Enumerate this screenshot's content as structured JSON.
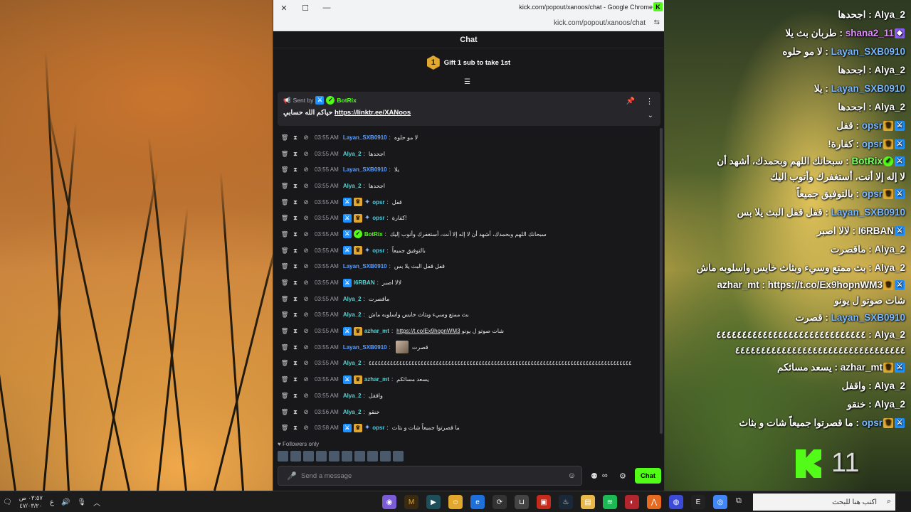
{
  "window": {
    "title": "kick.com/popout/xanoos/chat - Google Chrome",
    "url": "kick.com/popout/xanoos/chat",
    "favicon": "K"
  },
  "chat": {
    "header": "Chat",
    "gift_number": "1",
    "gift_text": "Gift 1 sub to take 1st",
    "pinned": {
      "sent_by": "Sent by",
      "bot": "BotRix",
      "message_prefix": "حياكم الله حسابي",
      "link": "https://linktr.ee/XANoos"
    },
    "messages": [
      {
        "time": "03:55 AM",
        "user": "Layan_SXB0910",
        "text": "لا مو حلوه"
      },
      {
        "time": "03:55 AM",
        "user": "Alya_2",
        "text": "اجحدها"
      },
      {
        "time": "03:55 AM",
        "user": "Layan_SXB0910",
        "text": "يلا"
      },
      {
        "time": "03:55 AM",
        "user": "Alya_2",
        "text": "اجحدها"
      },
      {
        "time": "03:55 AM",
        "user": "opsr",
        "text": "قفل"
      },
      {
        "time": "03:55 AM",
        "user": "opsr",
        "text": "كفارة!"
      },
      {
        "time": "03:55 AM",
        "user": "BotRix",
        "text": "سبحانك اللهم وبحمدك، أشهد أن لا إله إلا أنت، أستغفرك وأتوب إليك"
      },
      {
        "time": "03:55 AM",
        "user": "opsr",
        "text": "بالتوفيق جميعاً"
      },
      {
        "time": "03:55 AM",
        "user": "Layan_SXB0910",
        "text": "قفل قفل البث يلا بس"
      },
      {
        "time": "03:55 AM",
        "user": "I6RBAN",
        "text": "لالا اصبر"
      },
      {
        "time": "03:55 AM",
        "user": "Alya_2",
        "text": "ماقصرت"
      },
      {
        "time": "03:55 AM",
        "user": "Alya_2",
        "text": "بث ممتع وسيء وبثاث خايس واسلوبه ماش"
      },
      {
        "time": "03:55 AM",
        "user": "azhar_mt",
        "text": "شات صوتو ل يونو",
        "link": "https://t.co/Ex9hopnWM3"
      },
      {
        "time": "03:55 AM",
        "user": "Layan_SXB0910",
        "text": "قصرت"
      },
      {
        "time": "03:55 AM",
        "user": "Alya_2",
        "text": "٤٤٤٤٤٤٤٤٤٤٤٤٤٤٤٤٤٤٤٤٤٤٤٤٤٤٤٤٤٤٤٤٤٤٤٤٤٤٤٤٤٤٤٤٤٤٤٤٤٤٤٤٤٤٤٤٤٤٤٤٤٤٤٤٤٤٤٤٤٤٤٤٤٤٤٤٤٤٤٤٤٤٤٤٤٤"
      },
      {
        "time": "03:55 AM",
        "user": "azhar_mt",
        "text": "يسعد مسائكم"
      },
      {
        "time": "03:55 AM",
        "user": "Alya_2",
        "text": "واقفل"
      },
      {
        "time": "03:56 AM",
        "user": "Alya_2",
        "text": "خنقو"
      },
      {
        "time": "03:58 AM",
        "user": "opsr",
        "text": "ما قصرتوا جميعاً شات و بثاث"
      }
    ],
    "followers_only": "Followers only",
    "input_placeholder": "Send a message",
    "send_label": "Chat"
  },
  "overlay": {
    "lines": [
      {
        "user": "Alya_2",
        "text": "اجحدها"
      },
      {
        "user": "shana2_11",
        "text": "طربان بث يلا"
      },
      {
        "user": "Layan_SXB0910",
        "text": "لا مو حلوه"
      },
      {
        "user": "Alya_2",
        "text": "اجحدها"
      },
      {
        "user": "Layan_SXB0910",
        "text": "يلا"
      },
      {
        "user": "Alya_2",
        "text": "اجحدها"
      },
      {
        "user": "opsr",
        "text": "قفل"
      },
      {
        "user": "opsr",
        "text": "كفارة!"
      },
      {
        "user": "BotRix",
        "text": "سبحانك اللهم وبحمدك، أشهد أن لا إله إلا أنت، أستغفرك وأتوب اليك"
      },
      {
        "user": "opsr",
        "text": "بالتوفيق جميعاً"
      },
      {
        "user": "Layan_SXB0910",
        "text": "قفل قفل البث يلا بس"
      },
      {
        "user": "I6RBAN",
        "text": "لالا اصبر"
      },
      {
        "user": "Alya_2",
        "text": "ماقصرت"
      },
      {
        "user": "Alya_2",
        "text": "بث ممتع وسيء وبثاث خايس واسلوبه ماش"
      },
      {
        "user": "azhar_mt",
        "text": "https://t.co/Ex9hopnWM3 شات صوتو ل يونو"
      },
      {
        "user": "Layan_SXB0910",
        "text": "قصرت"
      },
      {
        "user": "Alya_2",
        "text": "٤٤٤٤٤٤٤٤٤٤٤٤٤٤٤٤٤٤٤٤٤٤٤٤٤٤٤٤٤٤٤٤٤٤٤٤٤٤٤٤٤٤٤٤٤٤٤٤٤٤٤٤٤٤٤٤٤٤٤٤٤٤"
      },
      {
        "user": "azhar_mt",
        "text": "يسعد مسائكم"
      },
      {
        "user": "Alya_2",
        "text": "واقفل"
      },
      {
        "user": "Alya_2",
        "text": "خنقو"
      },
      {
        "user": "opsr",
        "text": "ما قصرتوا جميعاً شات و بثاث"
      }
    ],
    "viewer_count": "11"
  },
  "taskbar": {
    "time": "٠٣:٥٧ ص",
    "date": "٤٧/٠٣/٢٠",
    "lang": "ع",
    "search_placeholder": "اكتب هنا للبحث"
  }
}
